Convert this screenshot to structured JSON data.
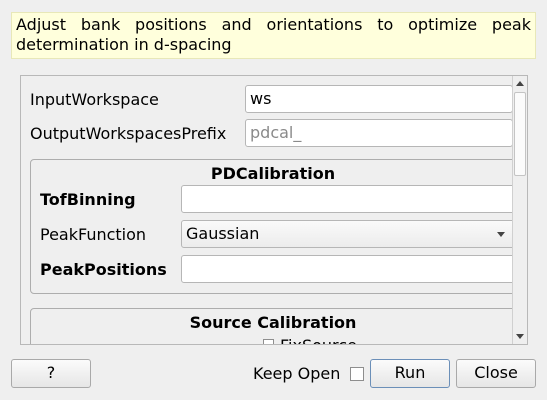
{
  "description": "Adjust bank positions and orientations to optimize peak determination in d-spacing",
  "fields": {
    "input_workspace": {
      "label": "InputWorkspace",
      "value": "ws"
    },
    "output_prefix": {
      "label": "OutputWorkspacesPrefix",
      "placeholder": "pdcal_"
    }
  },
  "pdcalibration": {
    "title": "PDCalibration",
    "tof_binning": {
      "label": "TofBinning",
      "value": ""
    },
    "peak_function": {
      "label": "PeakFunction",
      "value": "Gaussian"
    },
    "peak_positions": {
      "label": "PeakPositions",
      "value": ""
    }
  },
  "source_calibration": {
    "title": "Source Calibration",
    "fix_source_label": "FixSource"
  },
  "footer": {
    "help_label": "?",
    "keep_open_label": "Keep Open",
    "keep_open_checked": false,
    "run_label": "Run",
    "close_label": "Close"
  },
  "colors": {
    "description_bg": "#ffffdc",
    "window_bg": "#efefef",
    "default_button_border": "#6b8fb8"
  }
}
